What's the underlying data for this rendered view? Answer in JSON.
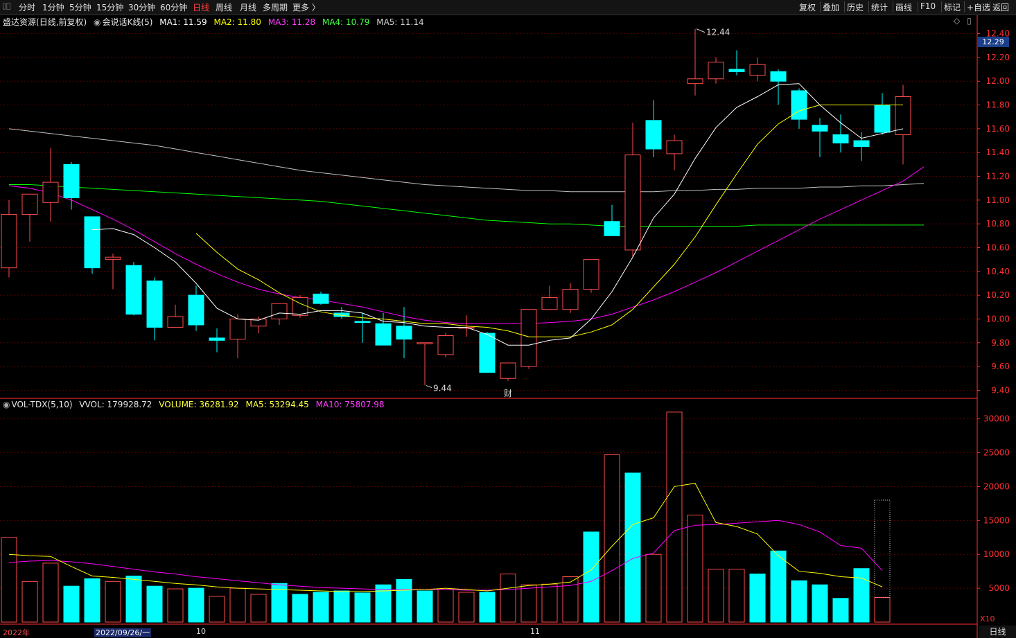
{
  "toolbar": {
    "logo_icon": "app-icon",
    "left_items": [
      "分时",
      "1分钟",
      "5分钟",
      "15分钟",
      "30分钟",
      "60分钟",
      "日线",
      "周线",
      "月线",
      "多周期",
      "更多 〉"
    ],
    "active_item": "日线",
    "right_items": [
      "复权",
      "叠加",
      "历史",
      "统计",
      "画线",
      "F10",
      "标记",
      "+自选",
      "返回"
    ]
  },
  "main_panel": {
    "stock_name": "盛达资源",
    "period": "(日线,前复权)",
    "indicator_name": "会说话K线(5)",
    "ma1": "MA1: 11.59",
    "ma2": "MA2: 11.80",
    "ma3": "MA3: 11.28",
    "ma4": "MA4: 10.79",
    "ma5": "MA5: 11.14",
    "current_price": "12.29",
    "icons": [
      "diamond-icon",
      "scroll-icon"
    ]
  },
  "volume_panel": {
    "indicator": "VOL-TDX(5,10)",
    "vvol": "VVOL: 179928.72",
    "volume": "VOLUME: 36281.92",
    "ma5": "MA5: 53294.45",
    "ma10": "MA10: 75807.98",
    "multiplier": "X10"
  },
  "bottom_bar": {
    "dates": [
      "2022年",
      "2022/09/26/一",
      "10",
      "11"
    ],
    "corner": "日线"
  },
  "colors": {
    "up": "#ff4d4d",
    "down": "#00ffff",
    "ma1": "#ffffff",
    "ma2": "#ffff00",
    "ma3": "#ff00ff",
    "ma4": "#00ff00",
    "ma5": "#c0c0c0",
    "grid": "#5a0000",
    "axis": "#ff3030"
  },
  "chart_data": [
    {
      "type": "candlestick",
      "y_ticks": [
        "12.40",
        "12.20",
        "12.00",
        "11.80",
        "11.60",
        "11.40",
        "11.20",
        "11.00",
        "10.80",
        "10.60",
        "10.40",
        "10.20",
        "10.00",
        "9.80",
        "9.60",
        "9.40"
      ],
      "ylim": [
        9.35,
        12.45
      ],
      "high_annotation": "12.44",
      "low_annotation": "9.44",
      "event_marker": "财",
      "candles": [
        {
          "o": 10.43,
          "h": 11.0,
          "l": 10.35,
          "c": 10.88
        },
        {
          "o": 10.88,
          "h": 11.05,
          "l": 10.65,
          "c": 11.05
        },
        {
          "o": 10.98,
          "h": 11.44,
          "l": 10.82,
          "c": 11.15
        },
        {
          "o": 11.3,
          "h": 11.32,
          "l": 10.92,
          "c": 11.02
        },
        {
          "o": 10.86,
          "h": 10.86,
          "l": 10.38,
          "c": 10.43
        },
        {
          "o": 10.5,
          "h": 10.55,
          "l": 10.25,
          "c": 10.52
        },
        {
          "o": 10.45,
          "h": 10.48,
          "l": 10.03,
          "c": 10.04
        },
        {
          "o": 10.32,
          "h": 10.35,
          "l": 9.82,
          "c": 9.93
        },
        {
          "o": 9.93,
          "h": 10.12,
          "l": 9.93,
          "c": 10.02
        },
        {
          "o": 10.2,
          "h": 10.28,
          "l": 9.9,
          "c": 9.95
        },
        {
          "o": 9.84,
          "h": 9.92,
          "l": 9.72,
          "c": 9.82
        },
        {
          "o": 9.83,
          "h": 10.04,
          "l": 9.67,
          "c": 10.0
        },
        {
          "o": 9.94,
          "h": 10.02,
          "l": 9.88,
          "c": 10.0
        },
        {
          "o": 10.0,
          "h": 10.13,
          "l": 9.95,
          "c": 10.13
        },
        {
          "o": 10.03,
          "h": 10.2,
          "l": 10.01,
          "c": 10.18
        },
        {
          "o": 10.21,
          "h": 10.23,
          "l": 10.12,
          "c": 10.13
        },
        {
          "o": 10.05,
          "h": 10.1,
          "l": 10.0,
          "c": 10.02
        },
        {
          "o": 9.98,
          "h": 10.05,
          "l": 9.8,
          "c": 9.97
        },
        {
          "o": 9.96,
          "h": 10.05,
          "l": 9.78,
          "c": 9.78
        },
        {
          "o": 9.94,
          "h": 10.1,
          "l": 9.67,
          "c": 9.83
        },
        {
          "o": 9.8,
          "h": 9.8,
          "l": 9.44,
          "c": 9.8
        },
        {
          "o": 9.7,
          "h": 9.88,
          "l": 9.68,
          "c": 9.86
        },
        {
          "o": 9.93,
          "h": 10.03,
          "l": 9.85,
          "c": 9.93
        },
        {
          "o": 9.88,
          "h": 9.89,
          "l": 9.55,
          "c": 9.55
        },
        {
          "o": 9.5,
          "h": 9.6,
          "l": 9.48,
          "c": 9.63
        },
        {
          "o": 9.6,
          "h": 10.08,
          "l": 9.58,
          "c": 10.08
        },
        {
          "o": 10.08,
          "h": 10.28,
          "l": 10.08,
          "c": 10.18
        },
        {
          "o": 10.08,
          "h": 10.3,
          "l": 10.05,
          "c": 10.25
        },
        {
          "o": 10.25,
          "h": 10.5,
          "l": 10.22,
          "c": 10.5
        },
        {
          "o": 10.82,
          "h": 10.96,
          "l": 10.7,
          "c": 10.7
        },
        {
          "o": 10.58,
          "h": 11.65,
          "l": 10.52,
          "c": 11.38
        },
        {
          "o": 11.67,
          "h": 11.84,
          "l": 11.36,
          "c": 11.43
        },
        {
          "o": 11.39,
          "h": 11.55,
          "l": 11.25,
          "c": 11.5
        },
        {
          "o": 11.98,
          "h": 12.44,
          "l": 11.88,
          "c": 12.02
        },
        {
          "o": 12.02,
          "h": 12.2,
          "l": 11.98,
          "c": 12.16
        },
        {
          "o": 12.1,
          "h": 12.26,
          "l": 12.05,
          "c": 12.08
        },
        {
          "o": 12.05,
          "h": 12.2,
          "l": 12.0,
          "c": 12.14
        },
        {
          "o": 12.08,
          "h": 12.1,
          "l": 11.8,
          "c": 12.0
        },
        {
          "o": 11.92,
          "h": 11.94,
          "l": 11.6,
          "c": 11.68
        },
        {
          "o": 11.63,
          "h": 11.69,
          "l": 11.36,
          "c": 11.58
        },
        {
          "o": 11.55,
          "h": 11.72,
          "l": 11.4,
          "c": 11.48
        },
        {
          "o": 11.5,
          "h": 11.57,
          "l": 11.33,
          "c": 11.45
        },
        {
          "o": 11.8,
          "h": 11.9,
          "l": 11.55,
          "c": 11.57
        },
        {
          "o": 11.55,
          "h": 11.97,
          "l": 11.3,
          "c": 11.87
        }
      ],
      "ma_lines": {
        "MA1": [
          null,
          null,
          null,
          null,
          10.75,
          10.76,
          10.71,
          10.6,
          10.48,
          10.3,
          10.09,
          10.0,
          9.99,
          10.05,
          10.04,
          10.07,
          10.07,
          10.05,
          9.98,
          9.97,
          9.94,
          9.93,
          9.93,
          9.87,
          9.78,
          9.78,
          9.82,
          9.84,
          10.0,
          10.23,
          10.52,
          10.85,
          11.05,
          11.35,
          11.61,
          11.78,
          11.87,
          11.97,
          11.98,
          11.8,
          11.65,
          11.52,
          11.56,
          11.6
        ],
        "MA2": [
          null,
          null,
          null,
          null,
          null,
          null,
          null,
          null,
          null,
          10.72,
          10.56,
          10.42,
          10.33,
          10.22,
          10.13,
          10.06,
          10.03,
          10.01,
          10.0,
          9.98,
          9.96,
          9.96,
          9.94,
          9.93,
          9.9,
          9.85,
          9.85,
          9.85,
          9.89,
          9.95,
          10.08,
          10.27,
          10.46,
          10.69,
          10.96,
          11.22,
          11.47,
          11.64,
          11.75,
          11.8,
          11.8,
          11.8,
          11.8,
          11.8
        ]
      },
      "smooth_lines": {
        "MA3": [
          11.12,
          11.1,
          11.06,
          11.0,
          10.92,
          10.84,
          10.75,
          10.65,
          10.55,
          10.46,
          10.38,
          10.31,
          10.25,
          10.21,
          10.18,
          10.16,
          10.13,
          10.1,
          10.06,
          10.02,
          9.99,
          9.97,
          9.96,
          9.96,
          9.96,
          9.96,
          9.97,
          9.98,
          10.0,
          10.04,
          10.1,
          10.16,
          10.23,
          10.31,
          10.39,
          10.48,
          10.57,
          10.66,
          10.75,
          10.84,
          10.92,
          11.0,
          11.08,
          11.16,
          11.28
        ],
        "MA4": [
          11.13,
          11.13,
          11.12,
          11.11,
          11.1,
          11.09,
          11.08,
          11.07,
          11.06,
          11.05,
          11.04,
          11.03,
          11.02,
          11.01,
          11.0,
          10.99,
          10.97,
          10.95,
          10.93,
          10.91,
          10.89,
          10.87,
          10.85,
          10.83,
          10.82,
          10.81,
          10.8,
          10.8,
          10.79,
          10.78,
          10.78,
          10.78,
          10.78,
          10.78,
          10.78,
          10.78,
          10.79,
          10.79,
          10.79,
          10.79,
          10.79,
          10.79,
          10.79,
          10.79,
          10.79
        ],
        "MA5": [
          11.6,
          11.58,
          11.56,
          11.54,
          11.52,
          11.5,
          11.48,
          11.46,
          11.43,
          11.4,
          11.37,
          11.34,
          11.31,
          11.28,
          11.25,
          11.23,
          11.21,
          11.19,
          11.17,
          11.15,
          11.13,
          11.12,
          11.11,
          11.1,
          11.09,
          11.08,
          11.08,
          11.07,
          11.07,
          11.07,
          11.07,
          11.07,
          11.08,
          11.08,
          11.09,
          11.09,
          11.1,
          11.1,
          11.1,
          11.11,
          11.11,
          11.12,
          11.12,
          11.13,
          11.14
        ]
      }
    },
    {
      "type": "bar",
      "title": "VOL-TDX(5,10)",
      "y_ticks": [
        "30000",
        "25000",
        "20000",
        "15000",
        "10000",
        "5000"
      ],
      "ylim": [
        0,
        31500
      ],
      "values": [
        12500,
        6000,
        8700,
        5300,
        6400,
        6000,
        6800,
        5300,
        4900,
        5000,
        3800,
        5000,
        4100,
        5700,
        4100,
        4400,
        4600,
        4300,
        5500,
        6300,
        4600,
        4800,
        4400,
        4400,
        7100,
        5500,
        5600,
        6700,
        13300,
        24700,
        22000,
        10000,
        31000,
        15800,
        7800,
        7800,
        7100,
        10500,
        6100,
        5500,
        3500,
        7900,
        3628
      ],
      "directions": [
        "up",
        "up",
        "up",
        "down",
        "down",
        "up",
        "down",
        "down",
        "up",
        "down",
        "up",
        "up",
        "up",
        "down",
        "down",
        "down",
        "down",
        "down",
        "down",
        "down",
        "down",
        "up",
        "up",
        "down",
        "up",
        "up",
        "up",
        "up",
        "down",
        "up",
        "down",
        "up",
        "up",
        "up",
        "up",
        "up",
        "down",
        "down",
        "down",
        "down",
        "down",
        "down",
        "up"
      ],
      "last_bar_dotted_max": 18000,
      "ma_volume": {
        "MA5": [
          10000,
          9800,
          9700,
          8200,
          6800,
          6600,
          6300,
          6000,
          5700,
          5500,
          5200,
          5000,
          4900,
          4800,
          4700,
          4600,
          4500,
          4500,
          4600,
          4700,
          4800,
          5000,
          4800,
          4600,
          5000,
          5400,
          5600,
          5900,
          7700,
          11200,
          14400,
          15400,
          20000,
          20500,
          14700,
          14100,
          13000,
          9800,
          7500,
          7200,
          6700,
          6500,
          5200
        ],
        "MA10": [
          8800,
          9000,
          9100,
          8900,
          8600,
          8200,
          7800,
          7400,
          7100,
          6700,
          6400,
          6100,
          5800,
          5500,
          5300,
          5100,
          5000,
          4900,
          4800,
          4800,
          4800,
          4800,
          4700,
          4700,
          4800,
          5000,
          5200,
          5400,
          6000,
          7600,
          9400,
          10200,
          13500,
          14300,
          14400,
          14600,
          14800,
          15000,
          14400,
          13300,
          11300,
          10900,
          7600
        ]
      }
    }
  ]
}
